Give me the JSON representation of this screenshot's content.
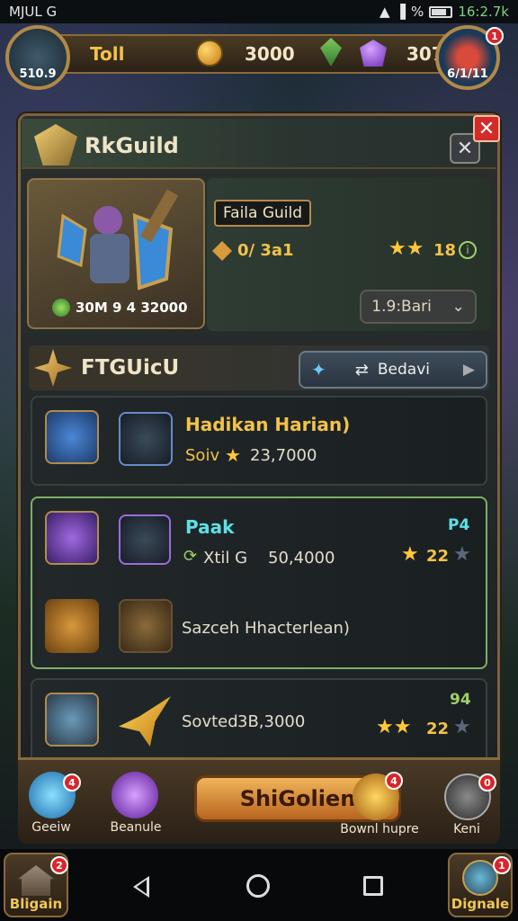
{
  "status_bar": {
    "left_text": "MJUL G",
    "battery_pct": "%",
    "time": "16:2.7k"
  },
  "top_bar": {
    "player_level": "510.9",
    "player_name": "Toll",
    "gold": "3000",
    "purple_gems": "307",
    "right_badge_value": "6/1/11",
    "right_badge_notif": "1"
  },
  "panel": {
    "title": "RkGuild",
    "guild": {
      "name": "Faila Guild",
      "hero_stats": "30M 9 4 32000",
      "resource_value": "0/ 3a1",
      "stars_count": 2,
      "stars_value": "18",
      "dropdown_label": "1.9:Bari"
    },
    "section": {
      "title": "FTGUicU",
      "browse_label": "Bedavi"
    },
    "list": [
      {
        "name": "Hadikan Harian)",
        "sub_prefix": "Soiv",
        "sub_value": "23,7000",
        "count": "",
        "stars": 0
      },
      {
        "name": "Paak",
        "sub_prefix": "Xtil G",
        "sub_value": "50,4000",
        "count": "P4",
        "stars": 1,
        "stars_value": "22",
        "secondary": "Sazceh Hhacterlean)"
      },
      {
        "name": "",
        "sub_prefix": "Sovted",
        "sub_value": "3B,3000",
        "count": "94",
        "stars": 2,
        "stars_value": "22"
      }
    ]
  },
  "action_bar": {
    "left1_label": "Geeiw",
    "left1_notif": "4",
    "left2_label": "Beanule",
    "main_button": "ShiGolien",
    "right1_label": "Bownl hupre",
    "right1_notif": "4",
    "right2_label": "Keni",
    "right2_notif": "0"
  },
  "corner_buttons": {
    "left_label": "Bligain",
    "left_notif": "2",
    "right_label": "Dignale",
    "right_notif": "1"
  },
  "colors": {
    "accent_gold": "#f2c24a",
    "star": "#ffc83a",
    "close_red": "#d32a2a"
  }
}
